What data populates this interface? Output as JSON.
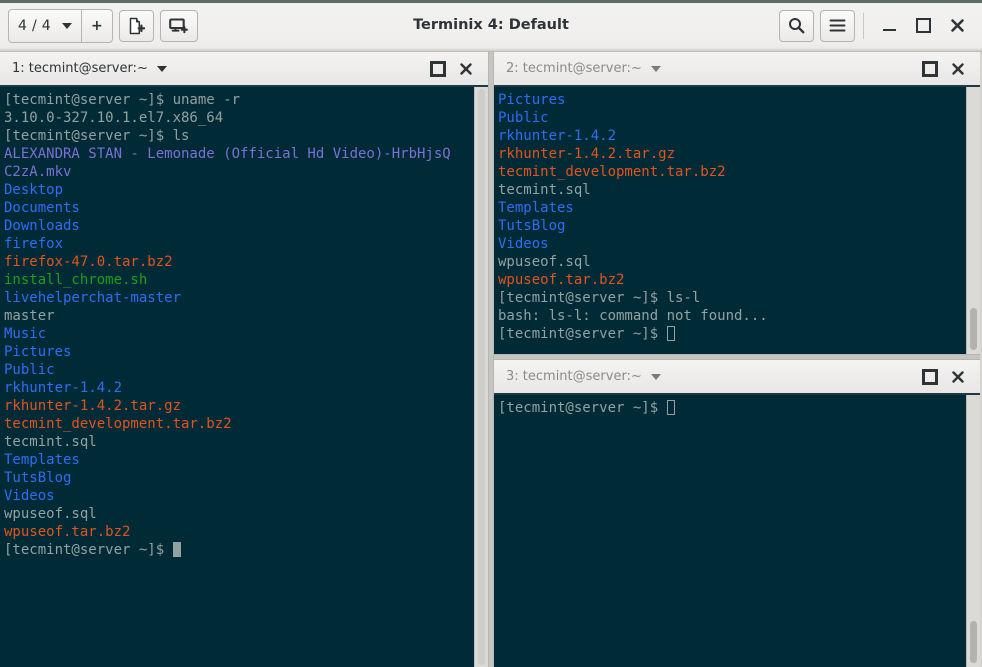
{
  "window": {
    "title": "Terminix 4: Default",
    "toolbar": {
      "session_count": "4 / 4",
      "session_dropdown_icon": "chevron-down-icon",
      "add_session_label": "+",
      "new_session_icon": "new-session-icon",
      "add_terminal_icon": "add-terminal-icon",
      "search_icon": "search-icon",
      "menu_icon": "hamburger-menu-icon"
    },
    "controls": {
      "minimize_icon": "minimize-icon",
      "maximize_icon": "maximize-icon",
      "close_icon": "close-icon"
    }
  },
  "colors": {
    "terminal_bg": "#002b36",
    "terminal_fg": "#93a1a1",
    "directory": "#2d6df6",
    "archive": "#e0551f",
    "executable": "#1aa01a",
    "media": "#7c6fd6",
    "titlebar_accent": "#5d6e66",
    "pane_header_underline": "#1b3b46"
  },
  "panes": [
    {
      "id": "pane-1",
      "title": "1: tecmint@server:~",
      "active": true,
      "maximize_icon": "maximize-pane-icon",
      "close_icon": "close-pane-icon",
      "scrollbar": {
        "visible": true,
        "thumb": "full"
      },
      "cursor": "solid",
      "lines": [
        [
          {
            "t": "[tecmint@server ~]$ uname -r",
            "c": "def"
          }
        ],
        [
          {
            "t": "3.10.0-327.10.1.el7.x86_64",
            "c": "def"
          }
        ],
        [
          {
            "t": "[tecmint@server ~]$ ls",
            "c": "def"
          }
        ],
        [
          {
            "t": "ALEXANDRA STAN - Lemonade (Official Hd Video)-HrbHjsQ",
            "c": "media"
          }
        ],
        [
          {
            "t": "C2zA.mkv",
            "c": "media"
          }
        ],
        [
          {
            "t": "Desktop",
            "c": "dir"
          }
        ],
        [
          {
            "t": "Documents",
            "c": "dir"
          }
        ],
        [
          {
            "t": "Downloads",
            "c": "dir"
          }
        ],
        [
          {
            "t": "firefox",
            "c": "dir"
          }
        ],
        [
          {
            "t": "firefox-47.0.tar.bz2",
            "c": "arch"
          }
        ],
        [
          {
            "t": "install_chrome.sh",
            "c": "exec"
          }
        ],
        [
          {
            "t": "livehelperchat-master",
            "c": "dir"
          }
        ],
        [
          {
            "t": "master",
            "c": "def"
          }
        ],
        [
          {
            "t": "Music",
            "c": "dir"
          }
        ],
        [
          {
            "t": "Pictures",
            "c": "dir"
          }
        ],
        [
          {
            "t": "Public",
            "c": "dir"
          }
        ],
        [
          {
            "t": "rkhunter-1.4.2",
            "c": "dir"
          }
        ],
        [
          {
            "t": "rkhunter-1.4.2.tar.gz",
            "c": "arch"
          }
        ],
        [
          {
            "t": "tecmint_development.tar.bz2",
            "c": "arch"
          }
        ],
        [
          {
            "t": "tecmint.sql",
            "c": "def"
          }
        ],
        [
          {
            "t": "Templates",
            "c": "dir"
          }
        ],
        [
          {
            "t": "TutsBlog",
            "c": "dir"
          }
        ],
        [
          {
            "t": "Videos",
            "c": "dir"
          }
        ],
        [
          {
            "t": "wpuseof.sql",
            "c": "def"
          }
        ],
        [
          {
            "t": "wpuseof.tar.bz2",
            "c": "arch"
          }
        ],
        [
          {
            "t": "[tecmint@server ~]$ ",
            "c": "def"
          },
          {
            "cursor": "solid"
          }
        ]
      ]
    },
    {
      "id": "pane-2",
      "title": "2: tecmint@server:~",
      "active": false,
      "maximize_icon": "maximize-pane-icon",
      "close_icon": "close-pane-icon",
      "scrollbar": {
        "visible": true,
        "thumb": "bottom"
      },
      "cursor": "hollow",
      "lines": [
        [
          {
            "t": "Pictures",
            "c": "dir"
          }
        ],
        [
          {
            "t": "Public",
            "c": "dir"
          }
        ],
        [
          {
            "t": "rkhunter-1.4.2",
            "c": "dir"
          }
        ],
        [
          {
            "t": "rkhunter-1.4.2.tar.gz",
            "c": "arch"
          }
        ],
        [
          {
            "t": "tecmint_development.tar.bz2",
            "c": "arch"
          }
        ],
        [
          {
            "t": "tecmint.sql",
            "c": "def"
          }
        ],
        [
          {
            "t": "Templates",
            "c": "dir"
          }
        ],
        [
          {
            "t": "TutsBlog",
            "c": "dir"
          }
        ],
        [
          {
            "t": "Videos",
            "c": "dir"
          }
        ],
        [
          {
            "t": "wpuseof.sql",
            "c": "def"
          }
        ],
        [
          {
            "t": "wpuseof.tar.bz2",
            "c": "arch"
          }
        ],
        [
          {
            "t": "[tecmint@server ~]$ ls-l",
            "c": "def"
          }
        ],
        [
          {
            "t": "bash: ls-l: command not found...",
            "c": "def"
          }
        ],
        [
          {
            "t": "[tecmint@server ~]$ ",
            "c": "def"
          },
          {
            "cursor": "hollow"
          }
        ]
      ]
    },
    {
      "id": "pane-3",
      "title": "3: tecmint@server:~",
      "active": false,
      "maximize_icon": "maximize-pane-icon",
      "close_icon": "close-pane-icon",
      "scrollbar": {
        "visible": true,
        "thumb": "bottom"
      },
      "cursor": "hollow",
      "lines": [
        [
          {
            "t": "[tecmint@server ~]$ ",
            "c": "def"
          },
          {
            "cursor": "hollow"
          }
        ]
      ]
    }
  ]
}
